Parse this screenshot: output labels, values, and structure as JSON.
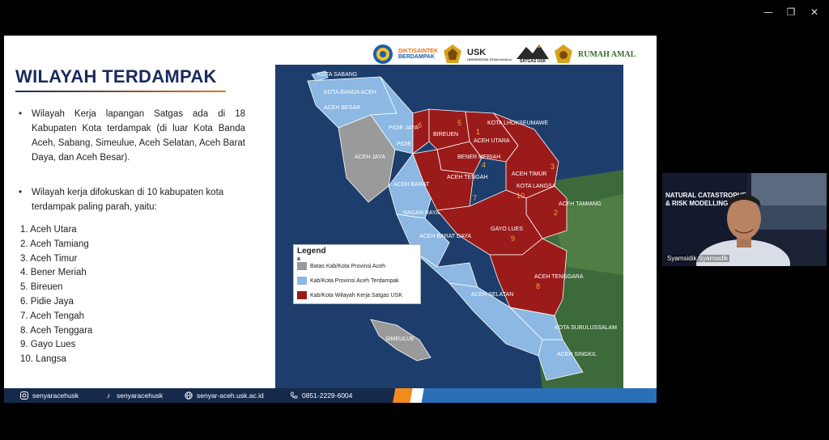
{
  "window": {
    "minimize_label": "—",
    "restore_label": "❐",
    "close_label": "✕"
  },
  "slide": {
    "title": "WILAYAH TERDAMPAK",
    "bullet1": "Wilayah Kerja lapangan Satgas ada di 18 Kabupaten Kota terdampak (di luar Kota Banda Aceh, Sabang, Simeulue, Aceh Selatan, Aceh Barat Daya, dan Aceh Besar).",
    "bullet2": "Wilayah kerja difokuskan di 10 kabupaten kota terdampak paling parah, yaitu:",
    "list": [
      "1. Aceh Utara",
      "2. Aceh Tamiang",
      "3. Aceh Timur",
      "4. Bener Meriah",
      "5. Bireuen",
      "6. Pidie Jaya",
      "7. Aceh Tengah",
      "8. Aceh Tenggara",
      "9. Gayo Lues",
      "10. Langsa"
    ],
    "logos": [
      "DIKTISAINTEK",
      "BERDAMPAK",
      "USK",
      "UNIVERSITAS SYIAH KUALA",
      "SATGAS USK",
      "RUMAH AMAL"
    ],
    "map_labels": {
      "kota_sabang": "KOTA SABANG",
      "kota_banda_aceh": "KOTA BANDA ACEH",
      "aceh_besar": "ACEH BESAR",
      "pidie_jaya": "PIDIE JAYA",
      "pidie": "PIDIE",
      "bireuen": "BIREUEN",
      "kota_lhokseumawe": "KOTA LHOKSEUMAWE",
      "aceh_utara": "ACEH UTARA",
      "bener_meriah": "BENER MERIAH",
      "aceh_jaya": "ACEH JAYA",
      "aceh_tengah": "ACEH TENGAH",
      "aceh_timur": "ACEH TIMUR",
      "kota_langsa": "KOTA LANGSA",
      "aceh_barat": "ACEH BARAT",
      "aceh_tamiang": "ACEH TAMIANG",
      "nagan_raya": "NAGAN RAYA",
      "gayo_lues": "GAYO LUES",
      "aceh_barat_daya": "ACEH BARAT DAYA",
      "aceh_tenggara": "ACEH TENGGARA",
      "aceh_selatan": "ACEH SELATAN",
      "simeulue": "SIMEULUE",
      "kota_subulussalam": "KOTA SUBULUSSALAM",
      "aceh_singkil": "ACEH SINGKIL"
    },
    "map_numbers": [
      "1",
      "2",
      "3",
      "4",
      "5",
      "6",
      "7",
      "8",
      "9",
      "10"
    ],
    "legend": {
      "title": "Legend",
      "subtitle": "a",
      "item1": "Batas Kab/Kota Provinsi Aceh",
      "item2": "Kab/Kota Provinsi Aceh Terdampak",
      "item3": "Kab/Kota Wilayah Kerja Satgas USK",
      "colors": {
        "gray": "#9a9a9a",
        "blue": "#8cb8e3",
        "red": "#9b1b1b"
      }
    },
    "footer": {
      "instagram": "senyaracehusk",
      "tiktok": "senyaracehusk",
      "website": "senyar-aceh.usk.ac.id",
      "phone": "0851-2229-6004"
    }
  },
  "video": {
    "name": "Syamsidik Syamsidik",
    "banner": "NATURAL CATASTROPHE & RISK MODELLING"
  }
}
